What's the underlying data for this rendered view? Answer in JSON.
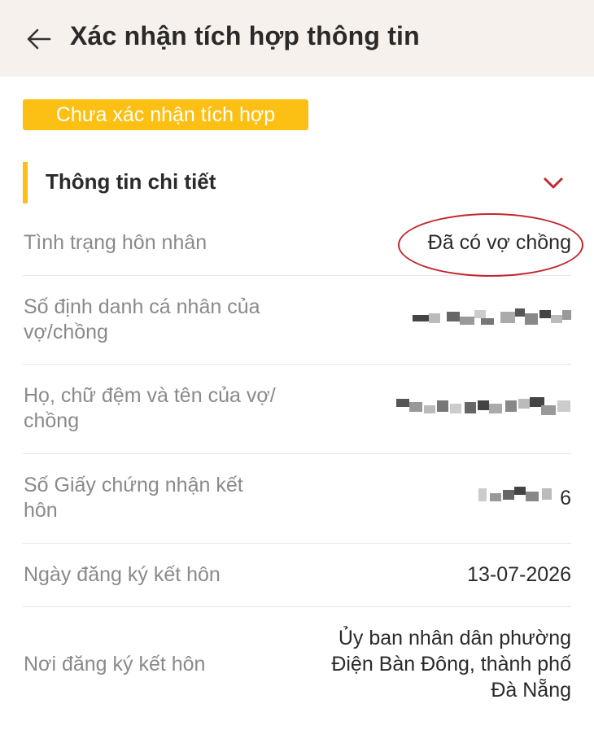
{
  "header": {
    "title": "Xác nhận tích hợp thông tin",
    "back_icon": "arrow-left-icon"
  },
  "status_badge": "Chưa xác nhận tích hợp",
  "section": {
    "title": "Thông tin chi tiết",
    "toggle_icon": "chevron-down-icon"
  },
  "rows": [
    {
      "label": "Tình trạng hôn nhân",
      "value": "Đã có vợ chồng"
    },
    {
      "label_line1": "Số định danh cá nhân của",
      "label_line2": "vợ/chồng"
    },
    {
      "label_line1": "Họ, chữ đệm và tên của vợ/",
      "label_line2": "chồng"
    },
    {
      "label_line1": "Số Giấy chứng nhận kết",
      "label_line2": "hôn",
      "value_tail": "6"
    },
    {
      "label": "Ngày đăng ký kết hôn",
      "value": "13-07-2026"
    },
    {
      "label": "Nơi đăng ký kết hôn",
      "value_line1": "Ủy ban nhân dân phường",
      "value_line2": "Điện Bàn Đông, thành phố",
      "value_line3": "Đà Nẵng"
    }
  ],
  "colors": {
    "accent_yellow": "#fcc015",
    "highlight_red": "#c3262e",
    "header_bg": "#f6f1ec"
  }
}
